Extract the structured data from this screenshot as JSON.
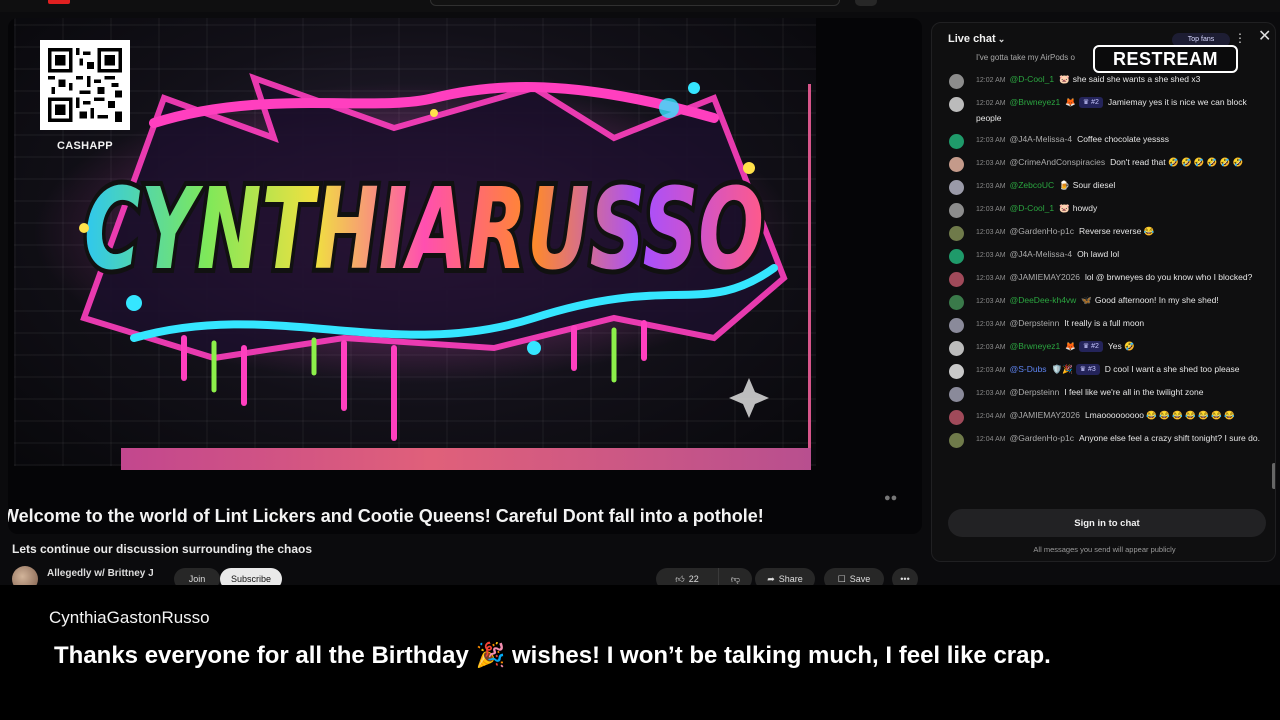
{
  "colors": {
    "background": "#0b0b0d",
    "chat_green": "#2ba640",
    "chat_blue": "#5e84f1",
    "banner_pink": "#d7558a"
  },
  "video": {
    "banner_text": "CYNTHIARUSSO",
    "cashapp_label": "CASHAPP",
    "ticker": "Welcome to the world of Lint Lickers and Cootie Queens!  Careful Dont fall into a pothole!",
    "title": "Lets continue our discussion surrounding the chaos",
    "channel": "Allegedly w/ Brittney J",
    "join_label": "Join",
    "subscribe_label": "Subscribe",
    "likes": "22",
    "like_icon": "thumbs-up-icon",
    "dislike_icon": "thumbs-down-icon",
    "share_label": "Share",
    "save_label": "Save",
    "more_label": "•••"
  },
  "chat": {
    "title": "Live chat",
    "top_fans_label": "Top fans",
    "close_label": "✕",
    "overlay_watermark": "RESTREAM",
    "cut_message": "I've gotta take my AirPods o",
    "messages": [
      {
        "time": "12:02 AM",
        "author": "@D-Cool_1",
        "author_color": "green",
        "emoji": "🐷",
        "badge": "",
        "text": "she said she wants a she shed x3",
        "avatar": "#8c8c8c"
      },
      {
        "time": "12:02 AM",
        "author": "@Brwneyez1",
        "author_color": "green",
        "emoji": "🦊",
        "badge": "♛ #2",
        "text": "Jamiemay yes it is nice we can block people",
        "avatar": "#bbbbbb"
      },
      {
        "time": "12:03 AM",
        "author": "@J4A-Melissa-4",
        "author_color": "gray",
        "emoji": "",
        "badge": "",
        "text": "Coffee chocolate yessss",
        "avatar": "#1f9a6a"
      },
      {
        "time": "12:03 AM",
        "author": "@CrimeAndConspiracies",
        "author_color": "gray",
        "emoji": "",
        "badge": "",
        "text": "Don't read that 🤣 🤣 🤣 🤣 🤣 🤣",
        "avatar": "#c49a8a"
      },
      {
        "time": "12:03 AM",
        "author": "@ZebcoUC",
        "author_color": "green",
        "emoji": "🍺",
        "badge": "",
        "text": "Sour diesel",
        "avatar": "#9a9aa8"
      },
      {
        "time": "12:03 AM",
        "author": "@D-Cool_1",
        "author_color": "green",
        "emoji": "🐷",
        "badge": "",
        "text": "howdy",
        "avatar": "#8c8c8c"
      },
      {
        "time": "12:03 AM",
        "author": "@GardenHo-p1c",
        "author_color": "gray",
        "emoji": "",
        "badge": "",
        "text": "Reverse reverse 😂",
        "avatar": "#6f7a4a"
      },
      {
        "time": "12:03 AM",
        "author": "@J4A-Melissa-4",
        "author_color": "gray",
        "emoji": "",
        "badge": "",
        "text": "Oh lawd lol",
        "avatar": "#1f9a6a"
      },
      {
        "time": "12:03 AM",
        "author": "@JAMIEMAY2026",
        "author_color": "gray",
        "emoji": "",
        "badge": "",
        "text": "lol @ brwneyes do you know who I blocked?",
        "avatar": "#a04a5a"
      },
      {
        "time": "12:03 AM",
        "author": "@DeeDee-kh4vw",
        "author_color": "green",
        "emoji": "🦋",
        "badge": "",
        "text": "Good afternoon! In my she shed!",
        "avatar": "#3a7a4a"
      },
      {
        "time": "12:03 AM",
        "author": "@Derpsteinn",
        "author_color": "gray",
        "emoji": "",
        "badge": "",
        "text": "It really is a full moon",
        "avatar": "#8a8a9a"
      },
      {
        "time": "12:03 AM",
        "author": "@Brwneyez1",
        "author_color": "green",
        "emoji": "🦊",
        "badge": "♛ #2",
        "text": "Yes 🤣",
        "avatar": "#bbbbbb"
      },
      {
        "time": "12:03 AM",
        "author": "@S-Dubs",
        "author_color": "blue",
        "emoji": "🛡️🎉",
        "badge": "♛ #3",
        "text": "D cool I want a she shed too please",
        "avatar": "#c8c8c8"
      },
      {
        "time": "12:03 AM",
        "author": "@Derpsteinn",
        "author_color": "gray",
        "emoji": "",
        "badge": "",
        "text": "I feel like we're all in the twilight zone",
        "avatar": "#8a8a9a"
      },
      {
        "time": "12:04 AM",
        "author": "@JAMIEMAY2026",
        "author_color": "gray",
        "emoji": "",
        "badge": "",
        "text": "Lmaooooooooo 😂 😂 😂 😂 😂 😂 😂",
        "avatar": "#a04a5a"
      },
      {
        "time": "12:04 AM",
        "author": "@GardenHo-p1c",
        "author_color": "gray",
        "emoji": "",
        "badge": "",
        "text": "Anyone else feel a crazy shift tonight? I sure do.",
        "avatar": "#6f7a4a"
      }
    ],
    "signin_label": "Sign in to chat",
    "public_note": "All messages you send will appear publicly"
  },
  "overlay": {
    "name": "CynthiaGastonRusso",
    "message": "Thanks everyone for all the Birthday 🎉 wishes! I won’t be talking much, I feel like crap."
  }
}
